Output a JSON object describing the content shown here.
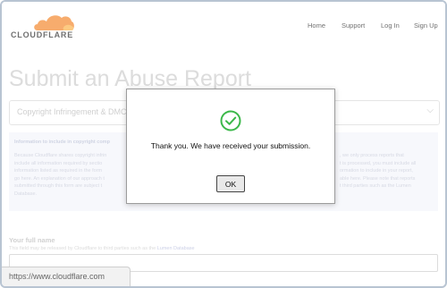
{
  "header": {
    "logo_text": "CLOUDFLARE",
    "nav": [
      "Home",
      "Support",
      "Log In",
      "Sign Up"
    ]
  },
  "page": {
    "title": "Submit an Abuse Report",
    "select_value": "Copyright Infringement & DMC",
    "info_heading": "Information to include in copyright comp",
    "info_left": [
      "Because Cloudflare shares copyright infrin",
      "include all information required by sectio",
      "information listed as required in the form",
      "go here. An explanation of our approach t",
      "submitted through this form are subject t",
      "Database."
    ],
    "info_right": [
      ", we only process reports that",
      "t is processed, you must include all",
      "ormation to include in your report,",
      "able here. Please note that reports",
      "t third parties such as the Lumen"
    ],
    "name_label": "Your full name",
    "name_help": "This field may be released by Cloudflare to third parties such as the ",
    "name_help_link": "Lumen Database"
  },
  "dialog": {
    "message": "Thank you. We have received your submission.",
    "ok_label": "OK"
  },
  "status_url": "https://www.cloudflare.com",
  "colors": {
    "brand_orange": "#f38020",
    "success_green": "#3cb84a"
  }
}
